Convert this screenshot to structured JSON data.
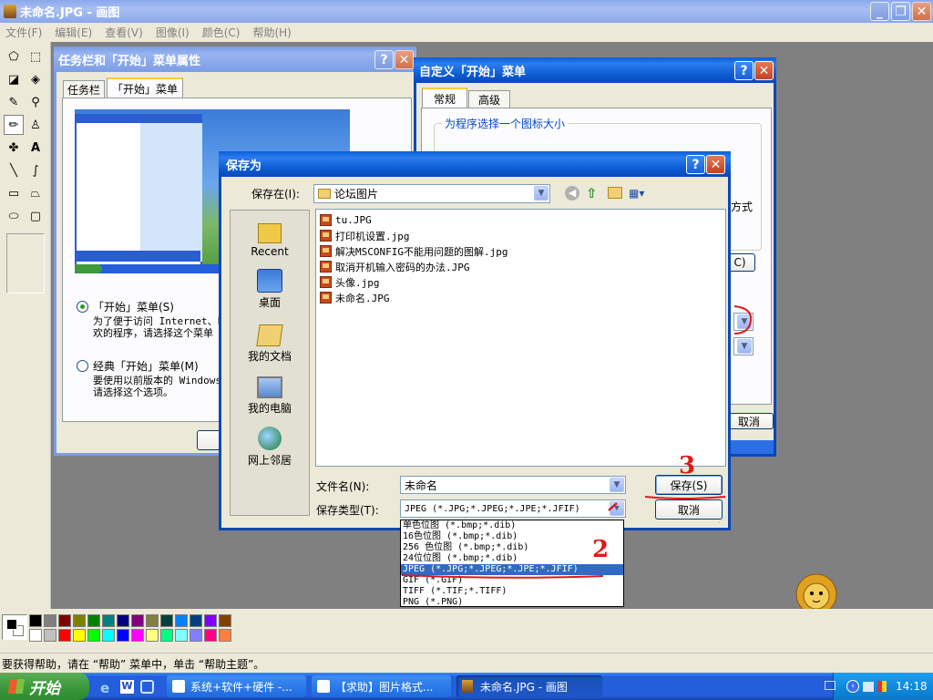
{
  "paint": {
    "title": "未命名.JPG - 画图",
    "menu": [
      "文件(F)",
      "编辑(E)",
      "查看(V)",
      "图像(I)",
      "颜色(C)",
      "帮助(H)"
    ],
    "status": "要获得帮助，请在 “帮助” 菜单中，单击 “帮助主题”。",
    "palette_top": [
      "#000000",
      "#808080",
      "#800000",
      "#808000",
      "#008000",
      "#008080",
      "#000080",
      "#800080",
      "#808040",
      "#004040",
      "#0080ff",
      "#004080",
      "#8000ff",
      "#804000"
    ],
    "palette_bottom": [
      "#ffffff",
      "#c0c0c0",
      "#ff0000",
      "#ffff00",
      "#00ff00",
      "#00ffff",
      "#0000ff",
      "#ff00ff",
      "#ffff80",
      "#00ff80",
      "#80ffff",
      "#8080ff",
      "#ff0080",
      "#ff8040"
    ]
  },
  "taskbar_props": {
    "title": "任务栏和「开始」菜单属性",
    "tabs": [
      "任务栏",
      "「开始」菜单"
    ],
    "option1_label": "「开始」菜单(S)",
    "option1_desc1": "为了便于访问 Internet、E",
    "option1_desc2": "欢的程序，请选择这个菜单",
    "option2_label": "经典「开始」菜单(M)",
    "option2_desc1": "要使用以前版本的 Windows",
    "option2_desc2": "请选择这个选项。"
  },
  "custom_start": {
    "title": "自定义「开始」菜单",
    "tabs": [
      "常规",
      "高级"
    ],
    "group_label": "为程序选择一个图标大小",
    "side_text": "方式",
    "btn_c": "C)",
    "cancel_partial": "取消"
  },
  "save_dialog": {
    "title": "保存为",
    "save_in_label": "保存在(I):",
    "save_in_value": "论坛图片",
    "places": [
      "Recent",
      "桌面",
      "我的文档",
      "我的电脑",
      "网上邻居"
    ],
    "files": [
      "tu.JPG",
      "打印机设置.jpg",
      "解决MSCONFIG不能用问题的图解.jpg",
      "取消开机输入密码的办法.JPG",
      "头像.jpg",
      "未命名.JPG"
    ],
    "filename_label": "文件名(N):",
    "filename_value": "未命名",
    "filetype_label": "保存类型(T):",
    "filetype_value": "JPEG (*.JPG;*.JPEG;*.JPE;*.JFIF)",
    "save_button": "保存(S)",
    "cancel_button": "取消",
    "type_options": [
      "单色位图 (*.bmp;*.dib)",
      "16色位图 (*.bmp;*.dib)",
      "256 色位图 (*.bmp;*.dib)",
      "24位位图 (*.bmp;*.dib)",
      "JPEG (*.JPG;*.JPEG;*.JPE;*.JFIF)",
      "GIF (*.GIF)",
      "TIFF (*.TIF;*.TIFF)",
      "PNG (*.PNG)"
    ],
    "selected_option": 4
  },
  "annotations": [
    "3",
    "2"
  ],
  "taskbar": {
    "start": "开始",
    "tasks": [
      "系统+软件+硬件 -...",
      "【求助】图片格式...",
      "未命名.JPG - 画图"
    ],
    "clock": "14:18"
  },
  "colors": {
    "xp_blue": "#0a5fd8",
    "dialog_face": "#ece9d8",
    "taskbar": "#245edb",
    "start_green": "#3c9a3c",
    "annotation_red": "#e01818"
  }
}
